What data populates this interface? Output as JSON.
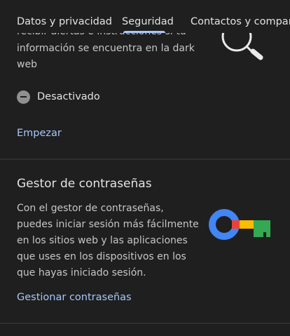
{
  "tabs": [
    {
      "label": "Datos y privacidad",
      "active": false
    },
    {
      "label": "Seguridad",
      "active": true
    },
    {
      "label": "Contactos y compartir",
      "active": false
    }
  ],
  "dark_web": {
    "description": "recibir alertas e instrucciones si tu información se encuentra en la dark web",
    "status": "Desactivado",
    "action": "Empezar",
    "icon": "magnifier-icon"
  },
  "password_manager": {
    "title": "Gestor de contraseñas",
    "description": "Con el gestor de contraseñas, puedes iniciar sesión más fácilmente en los sitios web y las aplicaciones que uses en los dispositivos en los que hayas iniciado sesión.",
    "action": "Gestionar contraseñas",
    "icon": "google-key-icon"
  },
  "colors": {
    "background": "#1f1f1f",
    "link": "#a8c7fa",
    "text": "#e3e3e3",
    "secondary_text": "#c4c7c5"
  }
}
